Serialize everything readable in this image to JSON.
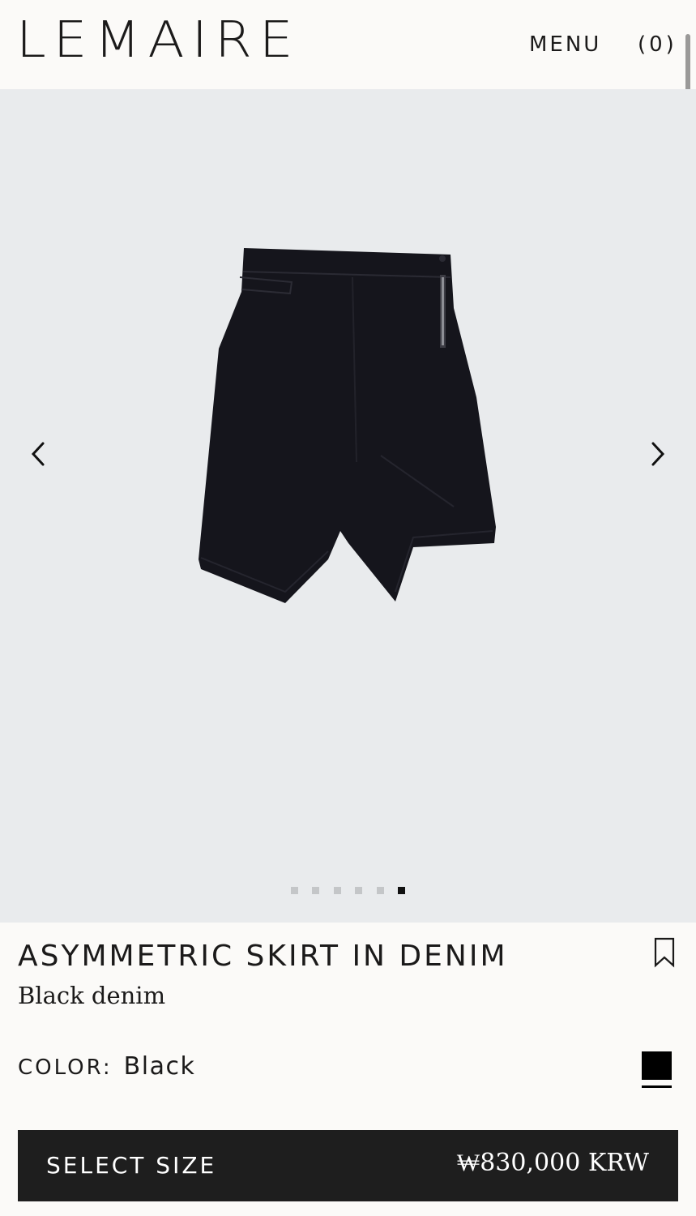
{
  "header": {
    "logo": "LEMAIRE",
    "menu_label": "MENU",
    "cart_label": "(0)"
  },
  "gallery": {
    "image_count": 6,
    "active_index": 5,
    "background_color": "#e9ebed",
    "garment_color": "#15151c",
    "prev_icon": "chevron-left-icon",
    "next_icon": "chevron-right-icon"
  },
  "product": {
    "title": "ASYMMETRIC SKIRT IN DENIM",
    "subtitle": "Black denim",
    "wishlist_icon": "bookmark-icon",
    "color_label": "COLOR:",
    "color_value": "Black",
    "swatch_color": "#000000"
  },
  "cta": {
    "label": "SELECT SIZE",
    "price": "₩830,000 KRW",
    "background": "#1e1e1e"
  }
}
